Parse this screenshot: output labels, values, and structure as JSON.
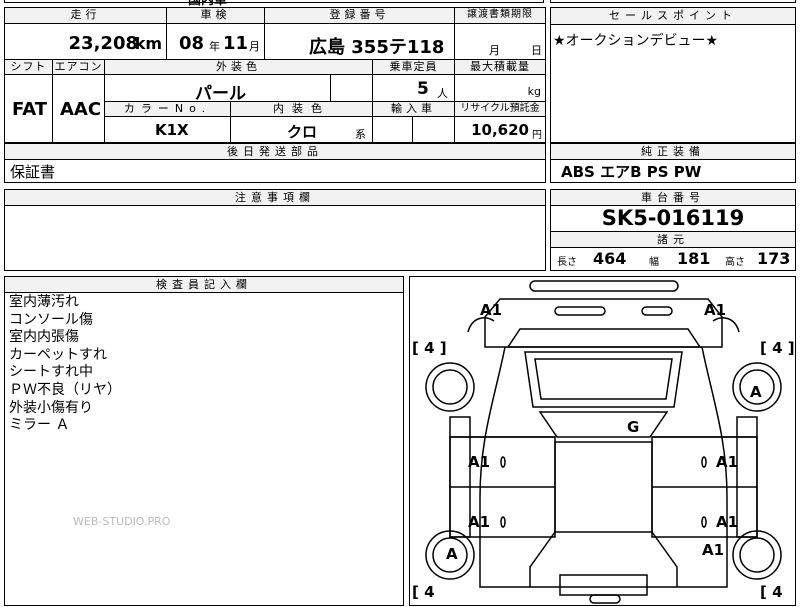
{
  "top_partial": {
    "text": "国内車"
  },
  "mileage": {
    "label": "走行",
    "value": "23,208",
    "unit": "km"
  },
  "inspection": {
    "label": "車検",
    "year": "08",
    "year_unit": "年",
    "month": "11",
    "month_unit": "月"
  },
  "registration": {
    "label": "登録番号",
    "value": "広島 355テ118"
  },
  "transfer_deadline": {
    "label": "譲渡書類期限",
    "month_unit": "月",
    "day_unit": "日"
  },
  "sales_point": {
    "label": "セールスポイント",
    "text": "★オークションデビュー★"
  },
  "shift": {
    "label": "シフト",
    "value": "FAT"
  },
  "aircon": {
    "label": "エアコン",
    "value": "AAC"
  },
  "exterior_color": {
    "label": "外装色",
    "value": "パール"
  },
  "capacity": {
    "label": "乗車定員",
    "value": "5",
    "unit": "人"
  },
  "max_load": {
    "label": "最大積載量",
    "unit": "kg"
  },
  "color_no": {
    "label": "カラーNo.",
    "value": "K1X"
  },
  "interior_color": {
    "label": "内装色",
    "value": "クロ",
    "suffix": "系"
  },
  "import_car": {
    "label": "輸入車"
  },
  "recycle": {
    "label": "リサイクル預託金",
    "value": "10,620",
    "unit": "円"
  },
  "later_parts": {
    "label": "後日発送部品",
    "value": "保証書"
  },
  "equipment": {
    "label": "純正装備",
    "value": "ABS エアB PS PW"
  },
  "notes": {
    "label": "注意事項欄"
  },
  "chassis": {
    "label": "車台番号",
    "value": "SK5-016119"
  },
  "specs": {
    "label": "諸元",
    "length_label": "長さ",
    "length": "464",
    "width_label": "幅",
    "width": "181",
    "height_label": "高さ",
    "height": "173"
  },
  "inspector": {
    "label": "検査員記入欄",
    "lines": [
      "室内薄汚れ",
      "コンソール傷",
      "室内内張傷",
      "カーペットすれ",
      "シートすれ中",
      "ＰＷ不良（リヤ）",
      "外装小傷有り",
      "ミラー Ａ"
    ]
  },
  "watermark": "WEB-STUDIO.PRO",
  "diagram": {
    "tires": [
      "[ 4 ]",
      "[ 4 ]",
      "[ 4",
      "[ 4"
    ],
    "damage": [
      "A1",
      "A1",
      "A",
      "G",
      "A1",
      "A1",
      "A1",
      "A1",
      "A",
      "A1"
    ]
  }
}
